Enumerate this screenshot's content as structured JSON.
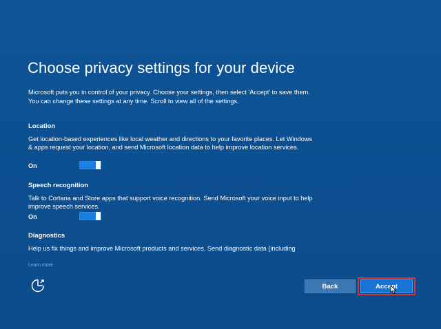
{
  "page": {
    "title": "Choose privacy settings for your device",
    "intro": "Microsoft puts you in control of your privacy. Choose your settings, then select 'Accept' to save them. You can change these settings at any time. Scroll to view all of the settings."
  },
  "sections": [
    {
      "heading": "Location",
      "description": "Get location-based experiences like local weather and directions to your favorite places. Let Windows & apps request your location, and send Microsoft location data to help improve location services.",
      "toggle_label": "On",
      "toggle_on": true
    },
    {
      "heading": "Speech recognition",
      "description": "Talk to Cortana and Store apps that support voice recognition. Send Microsoft your voice input to help improve speech services.",
      "toggle_label": "On",
      "toggle_on": true
    },
    {
      "heading": "Diagnostics",
      "description": "Help us fix things and improve Microsoft products and services. Send diagnostic data (including"
    }
  ],
  "footer": {
    "learn_more": "Learn more",
    "back_label": "Back",
    "accept_label": "Accept",
    "accessibility_icon": "ease-of-access-icon"
  },
  "colors": {
    "background": "#0d4f91",
    "toggle_on": "#1a7ee0",
    "accept_button": "#1674d6",
    "back_button": "#3b77b3",
    "highlight_box": "#d8323a",
    "link": "#7fb2e6"
  }
}
